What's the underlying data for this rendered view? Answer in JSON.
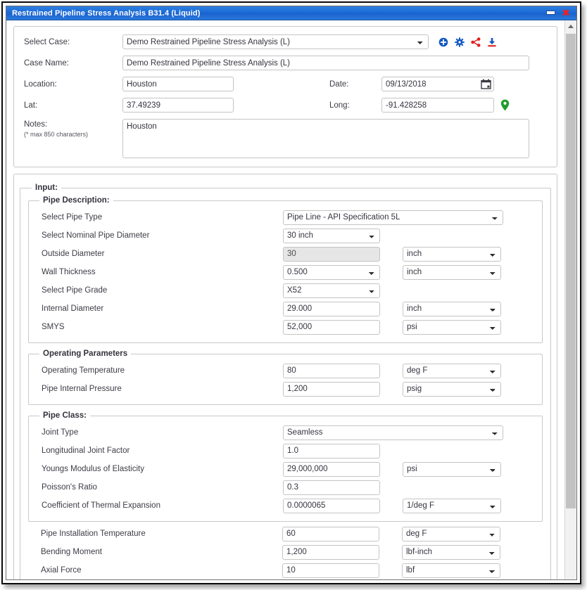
{
  "window": {
    "title": "Restrained Pipeline Stress Analysis B31.4 (Liquid)",
    "minimize_label": "minimize",
    "close_label": "✖"
  },
  "case_panel": {
    "select_case_label": "Select Case:",
    "select_case_value": "Demo Restrained Pipeline Stress Analysis (L)",
    "case_name_label": "Case Name:",
    "case_name_value": "Demo Restrained Pipeline Stress Analysis (L)",
    "location_label": "Location:",
    "location_value": "Houston",
    "date_label": "Date:",
    "date_value": "09/13/2018",
    "lat_label": "Lat:",
    "lat_value": "37.49239",
    "long_label": "Long:",
    "long_value": "-91.428258",
    "notes_label": "Notes:",
    "notes_hint": "(* max 850 characters)",
    "notes_value": "Houston",
    "icons": {
      "add": "add-circle-icon",
      "settings": "gear-icon",
      "share": "share-icon",
      "download": "download-icon",
      "calendar": "calendar-icon",
      "map_pin": "map-pin-icon"
    },
    "colors": {
      "add": "#1257c4",
      "gear": "#1257c4",
      "share": "#e02020",
      "download_top": "#1257c4",
      "download_bottom": "#e02020",
      "pin": "#1f9d2b",
      "title_bar": "#1a69d6",
      "close": "#ef2020"
    }
  },
  "input_section": {
    "legend": "Input:",
    "pipe_description": {
      "legend": "Pipe Description:",
      "rows": [
        {
          "label": "Select Pipe Type",
          "value": "Pipe Line - API Specification 5L",
          "control": "select",
          "width": "full",
          "unit": null
        },
        {
          "label": "Select Nominal Pipe Diameter",
          "value": "30 inch",
          "control": "select",
          "width": "narrow",
          "unit": null
        },
        {
          "label": "Outside Diameter",
          "value": "30",
          "control": "text-disabled",
          "width": "narrow",
          "unit": "inch"
        },
        {
          "label": "Wall Thickness",
          "value": "0.500",
          "control": "select",
          "width": "narrow",
          "unit": "inch"
        },
        {
          "label": "Select Pipe Grade",
          "value": "X52",
          "control": "select",
          "width": "narrow",
          "unit": null
        },
        {
          "label": "Internal Diameter",
          "value": "29.000",
          "control": "text",
          "width": "narrow",
          "unit": "inch"
        },
        {
          "label": "SMYS",
          "value": "52,000",
          "control": "text",
          "width": "narrow",
          "unit": "psi"
        }
      ]
    },
    "operating_parameters": {
      "legend": "Operating Parameters",
      "rows": [
        {
          "label": "Operating Temperature",
          "value": "80",
          "control": "text",
          "width": "narrow",
          "unit": "deg F"
        },
        {
          "label": "Pipe Internal Pressure",
          "value": "1,200",
          "control": "text",
          "width": "narrow",
          "unit": "psig"
        }
      ]
    },
    "pipe_class": {
      "legend": "Pipe Class:",
      "rows": [
        {
          "label": "Joint Type",
          "value": "Seamless",
          "control": "select",
          "width": "full",
          "unit": null
        },
        {
          "label": "Longitudinal Joint Factor",
          "value": "1.0",
          "control": "text",
          "width": "narrow",
          "unit": null
        },
        {
          "label": "Youngs Modulus of Elasticity",
          "value": "29,000,000",
          "control": "text",
          "width": "narrow",
          "unit": "psi"
        },
        {
          "label": "Poisson's Ratio",
          "value": "0.3",
          "control": "text",
          "width": "narrow",
          "unit": null
        },
        {
          "label": "Coefficient of Thermal Expansion",
          "value": "0.0000065",
          "control": "text",
          "width": "narrow",
          "unit": "1/deg F"
        }
      ]
    },
    "bottom_rows": [
      {
        "label": "Pipe Installation Temperature",
        "value": "60",
        "control": "text",
        "width": "narrow",
        "unit": "deg F"
      },
      {
        "label": "Bending Moment",
        "value": "1,200",
        "control": "text",
        "width": "narrow",
        "unit": "lbf-inch"
      },
      {
        "label": "Axial Force",
        "value": "10",
        "control": "text",
        "width": "narrow",
        "unit": "lbf"
      }
    ]
  }
}
